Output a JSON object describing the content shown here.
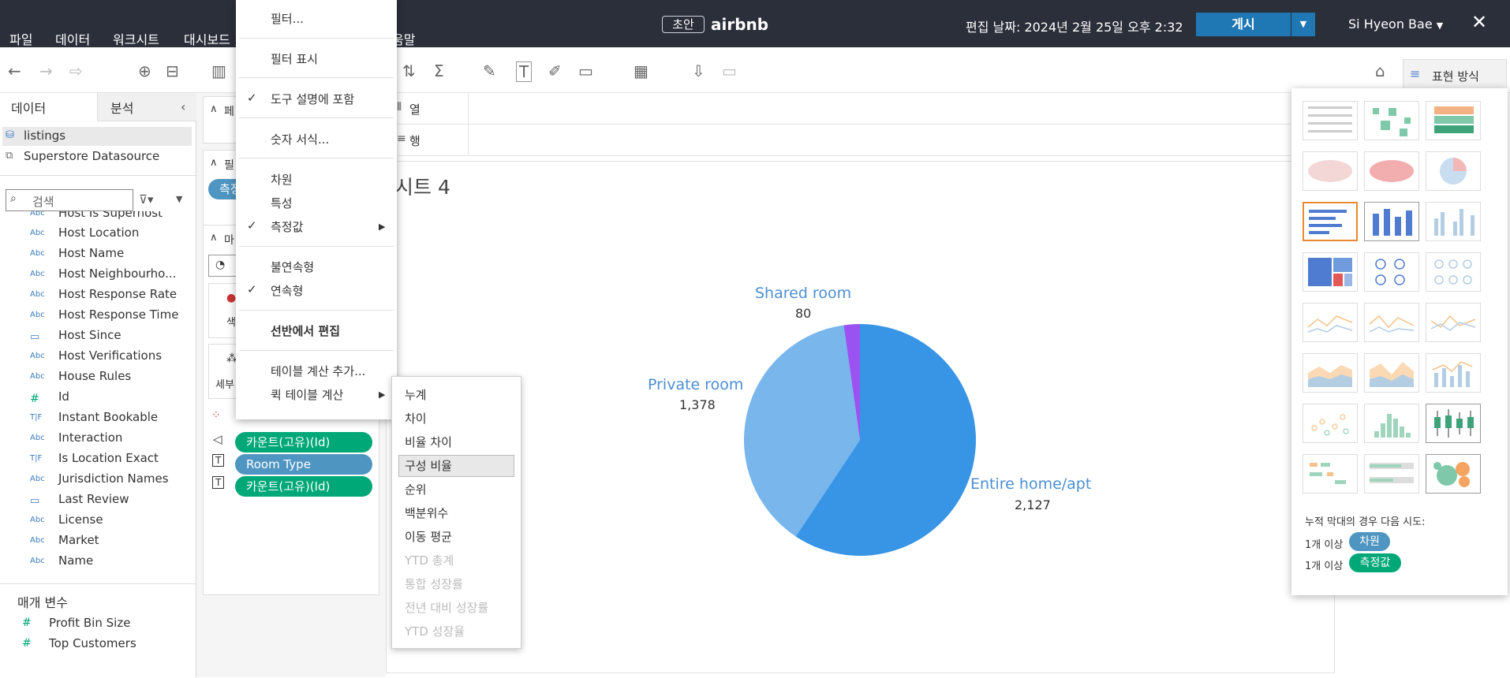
{
  "menubar": {
    "items": [
      "파일",
      "데이터",
      "워크시트",
      "대시보드",
      "움말"
    ]
  },
  "header": {
    "draft_badge": "초안",
    "workbook_title": "airbnb",
    "edit_date": "편집 날짜: 2024년 2월 25일 오후 2:32",
    "publish_label": "게시",
    "user_name": "Si Hyeon Bae",
    "close_icon": "close-icon"
  },
  "toolbar": {
    "show_me_label": "표현 방식"
  },
  "left_panel": {
    "tabs": [
      "데이터",
      "분석"
    ],
    "sources": [
      "listings",
      "Superstore Datasource"
    ],
    "search_placeholder": "검색",
    "fields": [
      {
        "type": "Abc",
        "name": "Host Is Superhost"
      },
      {
        "type": "Abc",
        "name": "Host Location"
      },
      {
        "type": "Abc",
        "name": "Host Name"
      },
      {
        "type": "Abc",
        "name": "Host Neighbourho..."
      },
      {
        "type": "Abc",
        "name": "Host Response Rate"
      },
      {
        "type": "Abc",
        "name": "Host Response Time"
      },
      {
        "type": "date",
        "name": "Host Since"
      },
      {
        "type": "Abc",
        "name": "Host Verifications"
      },
      {
        "type": "Abc",
        "name": "House Rules"
      },
      {
        "type": "#",
        "name": "Id"
      },
      {
        "type": "T|F",
        "name": "Instant Bookable"
      },
      {
        "type": "Abc",
        "name": "Interaction"
      },
      {
        "type": "T|F",
        "name": "Is Location Exact"
      },
      {
        "type": "Abc",
        "name": "Jurisdiction Names"
      },
      {
        "type": "date",
        "name": "Last Review"
      },
      {
        "type": "Abc",
        "name": "License"
      },
      {
        "type": "Abc",
        "name": "Market"
      },
      {
        "type": "Abc",
        "name": "Name"
      }
    ],
    "params_header": "매개 변수",
    "params": [
      "Profit Bin Size",
      "Top Customers"
    ]
  },
  "shelves": {
    "pages_abbr": "페",
    "filters_abbr": "필",
    "marks_abbr": "마",
    "filter_pill": "측정",
    "color_abbr": "색",
    "detail_abbr": "세부",
    "pills": [
      {
        "label": "카운트(고유)(Id)",
        "color": "#00a878"
      },
      {
        "label": "Room Type",
        "color": "#4f95c1"
      },
      {
        "label": "카운트(고유)(Id)",
        "color": "#00a878"
      }
    ],
    "columns_label": "열",
    "rows_label": "행"
  },
  "context_menu": {
    "items": [
      "필터...",
      "필터 표시",
      "도구 설명에 포함",
      "숫자 서식...",
      "차원",
      "특성",
      "측정값",
      "불연속형",
      "연속형",
      "선반에서 편집",
      "테이블 계산 추가...",
      "퀵 테이블 계산"
    ]
  },
  "submenu": {
    "items": [
      {
        "label": "누계",
        "enabled": true
      },
      {
        "label": "차이",
        "enabled": true
      },
      {
        "label": "비율 차이",
        "enabled": true
      },
      {
        "label": "구성 비율",
        "enabled": true
      },
      {
        "label": "순위",
        "enabled": true
      },
      {
        "label": "백분위수",
        "enabled": true
      },
      {
        "label": "이동 평균",
        "enabled": true
      },
      {
        "label": "YTD 총계",
        "enabled": false
      },
      {
        "label": "통합 성장률",
        "enabled": false
      },
      {
        "label": "전년 대비 성장률",
        "enabled": false
      },
      {
        "label": "YTD 성장율",
        "enabled": false
      }
    ]
  },
  "sheet": {
    "title": "시트 4"
  },
  "chart_data": {
    "type": "pie",
    "categories": [
      "Entire home/apt",
      "Private room",
      "Shared room"
    ],
    "values": [
      2127,
      1378,
      80
    ],
    "labels": [
      "2,127",
      "1,378",
      "80"
    ],
    "colors": [
      "#3895e6",
      "#78b6ec",
      "#9a52f1"
    ]
  },
  "show_me": {
    "hint": "누적 막대의 경우 다음 시도:",
    "row1_prefix": "1개 이상",
    "row1_pill": "차원",
    "row2_prefix": "1개 이상",
    "row2_pill": "측정값"
  }
}
